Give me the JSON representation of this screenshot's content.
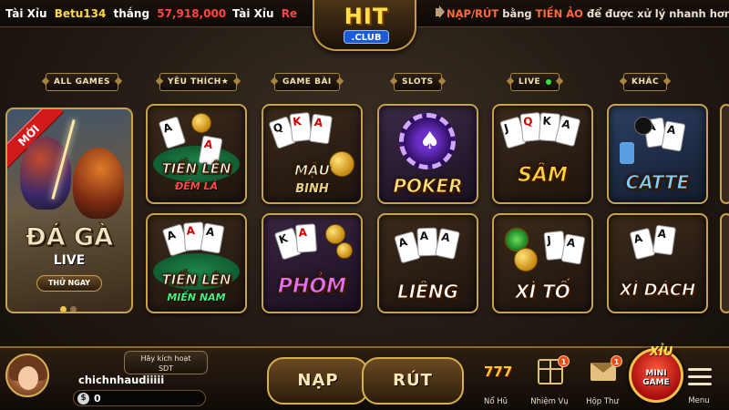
{
  "ticker": {
    "win1": {
      "game": "Tài Xỉu",
      "user": "Betu134",
      "verb": "thắng",
      "amount": "57,918,000"
    },
    "win2": {
      "game": "Tài Xỉu",
      "user": "Re"
    },
    "notice": {
      "part1": "NẠP/RÚT",
      "part2": "bằng",
      "part3": "TIỀN ẢO",
      "part4": "để được xử lý nhanh hơn"
    }
  },
  "logo": {
    "top": "HIT",
    "bottom": ".CLUB"
  },
  "tabs": [
    {
      "label": "ALL GAMES"
    },
    {
      "label": "YÊU THÍCH★"
    },
    {
      "label": "GAME BÀI"
    },
    {
      "label": "SLOTS"
    },
    {
      "label": "LIVE"
    },
    {
      "label": "KHÁC"
    }
  ],
  "featured": {
    "badge": "MỚI",
    "title": "ĐÁ GÀ",
    "subtitle": "LIVE",
    "button": "THỬ NGAY"
  },
  "games": {
    "tien_len_dem_la": {
      "title": "TIẾN LÊN",
      "subtitle": "ĐẾM LÁ"
    },
    "mau_binh": {
      "title": "MẬU",
      "subtitle": "BINH"
    },
    "poker": {
      "title": "POKER"
    },
    "sam": {
      "title": "SÂM"
    },
    "catte": {
      "title": "CATTE"
    },
    "tien_len_mien_nam": {
      "title": "TIẾN LÊN",
      "subtitle": "MIỀN NAM"
    },
    "phom": {
      "title": "PHỎM"
    },
    "lieng": {
      "title": "LIÊNG"
    },
    "xi_to": {
      "title": "XÌ TỐ"
    },
    "xi_dach": {
      "title": "XÌ DÁCH"
    }
  },
  "player": {
    "activate_line1": "Hãy kích hoạt",
    "activate_line2": "SDT",
    "username": "chichnhaudiiiii",
    "currency": "$",
    "balance": "0"
  },
  "actions": {
    "nap": "NẠP",
    "rut": "RÚT"
  },
  "nav": [
    {
      "label": "Nổ Hũ",
      "icon": "jackpot-777-icon"
    },
    {
      "label": "Nhiệm Vụ",
      "icon": "gift-box-icon",
      "badge": "1"
    },
    {
      "label": "Hộp Thư",
      "icon": "mail-icon",
      "badge": "1"
    }
  ],
  "minigame": {
    "top": "XỈU",
    "line1": "MINI",
    "line2": "GAME"
  },
  "menu": {
    "label": "Menu"
  },
  "colors": {
    "gold": "#c9a24e",
    "background": "#221a13",
    "win_amount": "#ff4545",
    "username_highlight": "#ffd84a"
  }
}
